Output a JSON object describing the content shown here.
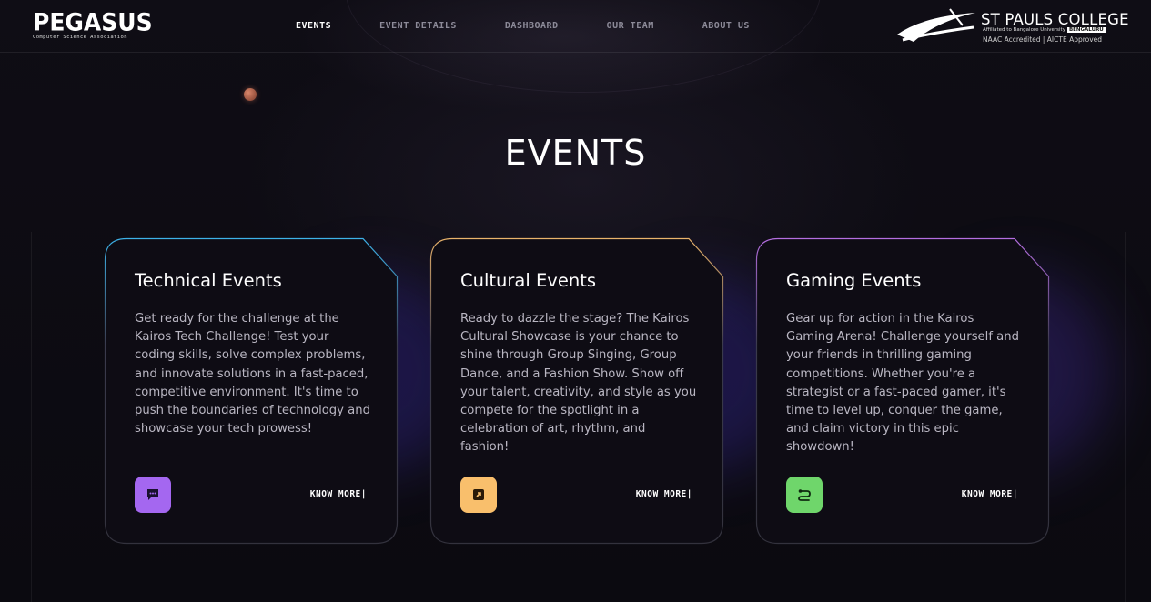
{
  "brand": {
    "name": "PEGASUS",
    "tagline": "Computer Science Association"
  },
  "nav": {
    "items": [
      {
        "label": "EVENTS"
      },
      {
        "label": "EVENT DETAILS"
      },
      {
        "label": "DASHBOARD"
      },
      {
        "label": "OUR TEAM"
      },
      {
        "label": "ABOUT US"
      }
    ],
    "active_index": 0
  },
  "college": {
    "name": "ST PAULS COLLEGE",
    "affiliation": "Affiliated to Bangalore University",
    "city_tag": "BENGALURU",
    "accreditation": "NAAC Accredited | AICTE Approved"
  },
  "page_title": "EVENTS",
  "cards": [
    {
      "title": "Technical Events",
      "description": "Get ready for the challenge at the Kairos Tech Challenge! Test your coding skills, solve complex problems, and innovate solutions in a fast-paced, competitive environment. It's time to push the boundaries of technology and showcase your tech prowess!",
      "icon": "chat-icon",
      "icon_color": "#a467f0",
      "border_color": "#3db2e8",
      "more_label": "KNOW MORE|"
    },
    {
      "title": "Cultural Events",
      "description": "Ready to dazzle the stage? The Kairos Cultural Showcase is your chance to shine through Group Singing, Group Dance, and a Fashion Show. Show off your talent, creativity, and style as you compete for the spotlight in a celebration of art, rhythm, and fashion!",
      "icon": "expand-icon",
      "icon_color": "#f9bf6c",
      "border_color": "#e9b36b",
      "more_label": "KNOW MORE|"
    },
    {
      "title": "Gaming Events",
      "description": "Gear up for action in the Kairos Gaming Arena! Challenge yourself and your friends in thrilling gaming competitions. Whether you're a strategist or a fast-paced gamer, it's time to level up, conquer the game, and claim victory in this epic showdown!",
      "icon": "controller-cable-icon",
      "icon_color": "#6fd66b",
      "border_color": "#b46ee0",
      "more_label": "KNOW MORE|"
    }
  ]
}
